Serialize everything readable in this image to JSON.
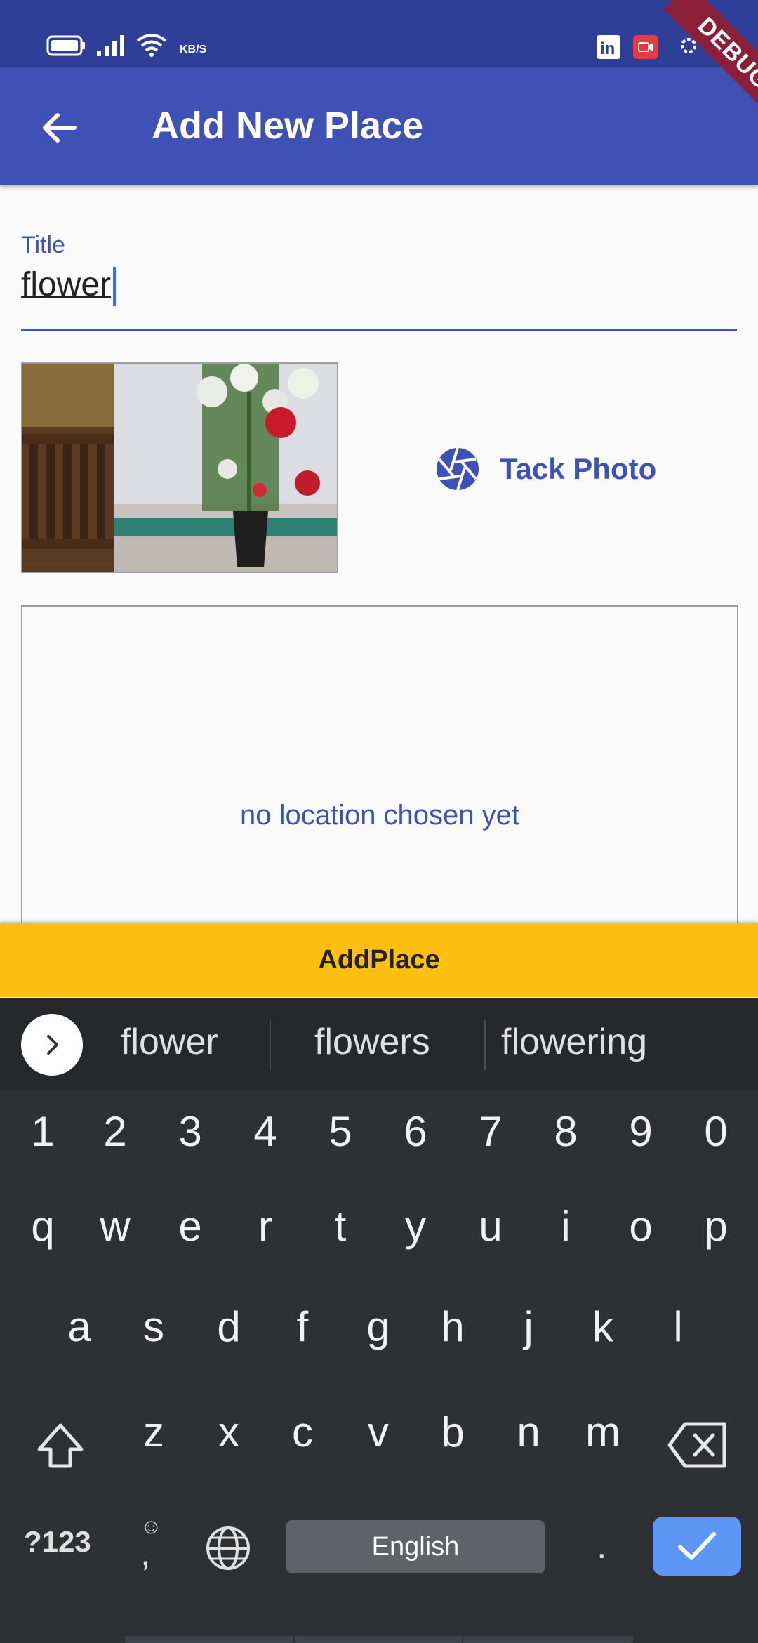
{
  "status_bar": {
    "speed_unit": "KB/S",
    "icons": [
      "battery-icon",
      "signal-icon",
      "wifi-icon",
      "linkedin-icon",
      "screen-record-icon",
      "settings-icon"
    ]
  },
  "debug_banner": "DEBUG",
  "app_bar": {
    "title": "Add New Place",
    "back_icon": "arrow-back-icon"
  },
  "form": {
    "title_label": "Title",
    "title_value": "flower",
    "photo_alt": "flower vase photo",
    "take_photo_label": "Tack Photo",
    "take_photo_icon": "camera-shutter-icon",
    "location_placeholder": "no location chosen yet"
  },
  "add_button": {
    "label": "AddPlace"
  },
  "keyboard": {
    "suggestions": [
      "flower",
      "flowers",
      "flowering"
    ],
    "number_row": [
      "1",
      "2",
      "3",
      "4",
      "5",
      "6",
      "7",
      "8",
      "9",
      "0"
    ],
    "row1": [
      "q",
      "w",
      "e",
      "r",
      "t",
      "y",
      "u",
      "i",
      "o",
      "p"
    ],
    "row2": [
      "a",
      "s",
      "d",
      "f",
      "g",
      "h",
      "j",
      "k",
      "l"
    ],
    "row3": [
      "z",
      "x",
      "c",
      "v",
      "b",
      "n",
      "m"
    ],
    "symbols_key": "?123",
    "comma_key": ",",
    "space_key": "English",
    "period_key": ".",
    "emoji_hint": "☺"
  },
  "colors": {
    "status_bar": "#2f3f98",
    "app_bar": "#3f51b5",
    "accent": "#3f51b5",
    "add_button": "#fdbf10",
    "keyboard_bg": "#2e3134",
    "enter_key": "#5d96f5"
  }
}
